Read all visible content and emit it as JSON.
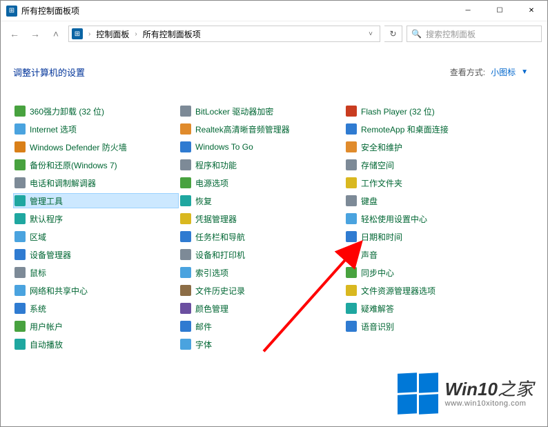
{
  "window": {
    "title": "所有控制面板项"
  },
  "nav": {
    "breadcrumb": [
      "控制面板",
      "所有控制面板项"
    ],
    "search_placeholder": "搜索控制面板"
  },
  "header": {
    "title": "调整计算机的设置",
    "viewby_label": "查看方式:",
    "viewby_value": "小图标"
  },
  "items": {
    "col1": [
      {
        "label": "360强力卸载 (32 位)",
        "icon": "c-green"
      },
      {
        "label": "Internet 选项",
        "icon": "c-sky"
      },
      {
        "label": "Windows Defender 防火墙",
        "icon": "c-shield"
      },
      {
        "label": "备份和还原(Windows 7)",
        "icon": "c-green"
      },
      {
        "label": "电话和调制解调器",
        "icon": "c-gray"
      },
      {
        "label": "管理工具",
        "icon": "c-teal",
        "selected": true
      },
      {
        "label": "默认程序",
        "icon": "c-teal"
      },
      {
        "label": "区域",
        "icon": "c-sky"
      },
      {
        "label": "设备管理器",
        "icon": "c-blue"
      },
      {
        "label": "鼠标",
        "icon": "c-gray"
      },
      {
        "label": "网络和共享中心",
        "icon": "c-sky"
      },
      {
        "label": "系统",
        "icon": "c-blue"
      },
      {
        "label": "用户帐户",
        "icon": "c-green"
      },
      {
        "label": "自动播放",
        "icon": "c-teal"
      }
    ],
    "col2": [
      {
        "label": "BitLocker 驱动器加密",
        "icon": "c-gray"
      },
      {
        "label": "Realtek高清晰音频管理器",
        "icon": "c-orange"
      },
      {
        "label": "Windows To Go",
        "icon": "c-blue"
      },
      {
        "label": "程序和功能",
        "icon": "c-gray"
      },
      {
        "label": "电源选项",
        "icon": "c-green"
      },
      {
        "label": "恢复",
        "icon": "c-teal"
      },
      {
        "label": "凭据管理器",
        "icon": "c-yellow"
      },
      {
        "label": "任务栏和导航",
        "icon": "c-blue"
      },
      {
        "label": "设备和打印机",
        "icon": "c-gray"
      },
      {
        "label": "索引选项",
        "icon": "c-sky"
      },
      {
        "label": "文件历史记录",
        "icon": "c-brown"
      },
      {
        "label": "颜色管理",
        "icon": "c-purple"
      },
      {
        "label": "邮件",
        "icon": "c-blue"
      },
      {
        "label": "字体",
        "icon": "c-sky"
      }
    ],
    "col3": [
      {
        "label": "Flash Player (32 位)",
        "icon": "c-red"
      },
      {
        "label": "RemoteApp 和桌面连接",
        "icon": "c-blue"
      },
      {
        "label": "安全和维护",
        "icon": "c-orange"
      },
      {
        "label": "存储空间",
        "icon": "c-gray"
      },
      {
        "label": "工作文件夹",
        "icon": "c-yellow"
      },
      {
        "label": "键盘",
        "icon": "c-gray"
      },
      {
        "label": "轻松使用设置中心",
        "icon": "c-sky"
      },
      {
        "label": "日期和时间",
        "icon": "c-blue"
      },
      {
        "label": "声音",
        "icon": "c-gray",
        "arrow_target": true
      },
      {
        "label": "同步中心",
        "icon": "c-green"
      },
      {
        "label": "文件资源管理器选项",
        "icon": "c-yellow"
      },
      {
        "label": "疑难解答",
        "icon": "c-teal"
      },
      {
        "label": "语音识别",
        "icon": "c-blue"
      }
    ]
  },
  "watermark": {
    "brand_main": "Win10",
    "brand_suffix": "之家",
    "url": "www.win10xitong.com"
  }
}
